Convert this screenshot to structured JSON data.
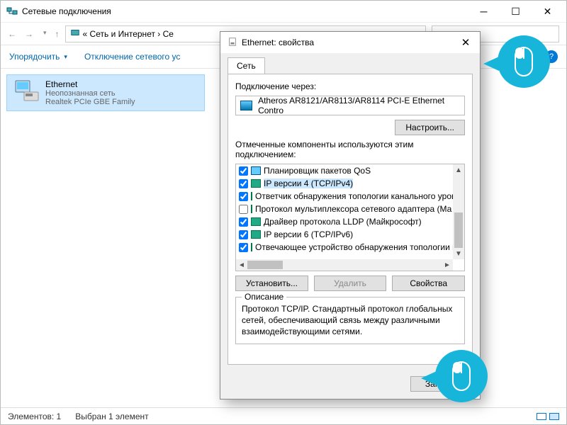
{
  "window": {
    "title": "Сетевые подключения",
    "breadcrumb": "«  Сеть и Интернет  ›  Се"
  },
  "toolbar": {
    "organize": "Упорядочить",
    "disable": "Отключение сетевого ус"
  },
  "adapter": {
    "name": "Ethernet",
    "status": "Неопознанная сеть",
    "device": "Realtek PCIe GBE Family"
  },
  "statusbar": {
    "count": "Элементов: 1",
    "selected": "Выбран 1 элемент"
  },
  "dialog": {
    "title": "Ethernet: свойства",
    "tab": "Сеть",
    "connect_label": "Подключение через:",
    "adapter_name": "Atheros AR8121/AR8113/AR8114 PCI-E Ethernet Contro",
    "configure_btn": "Настроить...",
    "components_label": "Отмеченные компоненты используются этим подключением:",
    "components": [
      {
        "checked": true,
        "iconClass": "svc-icon",
        "label": "Планировщик пакетов QoS",
        "selected": false
      },
      {
        "checked": true,
        "iconClass": "proto-icon",
        "label": "IP версии 4 (TCP/IPv4)",
        "selected": true
      },
      {
        "checked": true,
        "iconClass": "proto-icon",
        "label": "Ответчик обнаружения топологии канального уров",
        "selected": false
      },
      {
        "checked": false,
        "iconClass": "proto-icon",
        "label": "Протокол мультиплексора сетевого адаптера (Ма",
        "selected": false
      },
      {
        "checked": true,
        "iconClass": "proto-icon",
        "label": "Драйвер протокола LLDP (Майкрософт)",
        "selected": false
      },
      {
        "checked": true,
        "iconClass": "proto-icon",
        "label": "IP версии 6 (TCP/IPv6)",
        "selected": false
      },
      {
        "checked": true,
        "iconClass": "proto-icon",
        "label": "Отвечающее устройство обнаружения топологии к",
        "selected": false
      }
    ],
    "install_btn": "Установить...",
    "remove_btn": "Удалить",
    "props_btn": "Свойства",
    "desc_title": "Описание",
    "desc_text": "Протокол TCP/IP. Стандартный протокол глобальных сетей, обеспечивающий связь между различными взаимодействующими сетями.",
    "close_btn": "Закрыть"
  }
}
